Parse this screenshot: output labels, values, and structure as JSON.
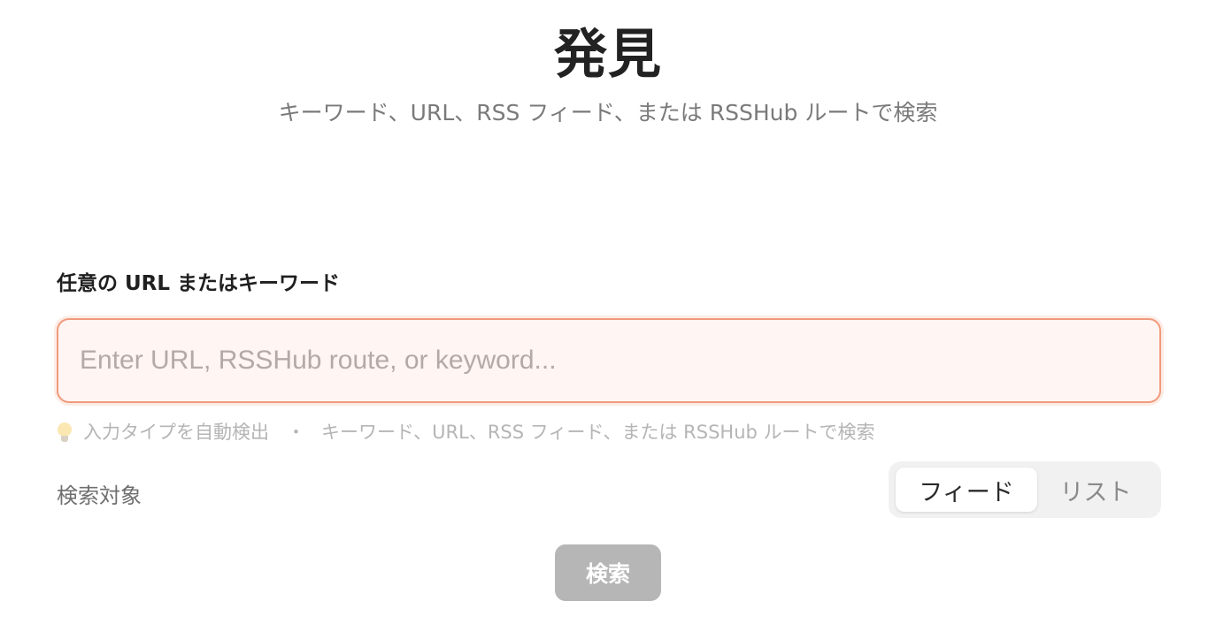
{
  "header": {
    "title": "発見",
    "subtitle": "キーワード、URL、RSS フィード、または RSSHub ルートで検索"
  },
  "form": {
    "label": "任意の URL またはキーワード",
    "input": {
      "value": "",
      "placeholder": "Enter URL, RSSHub route, or keyword..."
    },
    "hint": {
      "icon": "lightbulb-icon",
      "auto_detect": "入力タイプを自動検出",
      "separator": "・",
      "description": "キーワード、URL、RSS フィード、または RSSHub ルートで検索"
    },
    "target": {
      "label": "検索対象",
      "options": [
        "フィード",
        "リスト"
      ],
      "selected": "フィード"
    },
    "submit_label": "検索"
  },
  "colors": {
    "input_border": "#f19a7c",
    "input_background": "#fff5f2",
    "button_disabled": "#b6b6b6",
    "segment_track": "#f1f1f1"
  }
}
